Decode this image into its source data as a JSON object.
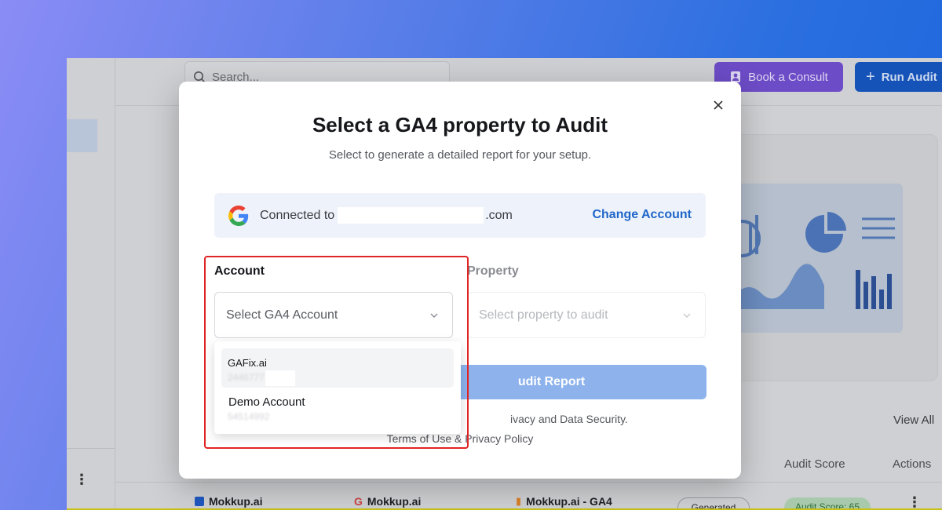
{
  "app": {
    "search_placeholder": "Search...",
    "book_consult_label": "Book a Consult",
    "run_audit_label": "Run Audit",
    "view_all_label": "View All",
    "table": {
      "columns": {
        "audit_score": "Audit Score",
        "actions": "Actions"
      },
      "row": {
        "col1": "Mokkup.ai",
        "col2": "Mokkup.ai",
        "col3": "Mokkup.ai - GA4",
        "status": "Generated",
        "score": "Audit Score: 65"
      }
    }
  },
  "modal": {
    "title": "Select a GA4 property to Audit",
    "subtitle": "Select to generate a detailed report for your setup.",
    "connected_prefix": "Connected to",
    "connected_suffix": ".com",
    "change_account": "Change Account",
    "account_label": "Account",
    "account_placeholder": "Select GA4 Account",
    "property_label": "Property",
    "property_placeholder": "Select property to audit",
    "generate_button_visible": "udit Report",
    "privacy_note_visible": "ivacy and Data Security.",
    "terms_visible": "Terms of Use & Privacy Policy"
  },
  "dropdown": {
    "options": [
      {
        "name": "GAFix.ai",
        "id": "24467777"
      },
      {
        "name": "Demo Account",
        "id": "54514992"
      }
    ]
  },
  "colors": {
    "accent": "#1f66c9",
    "highlight": "#e02424",
    "primary_button_disabled": "#8db2ec"
  }
}
